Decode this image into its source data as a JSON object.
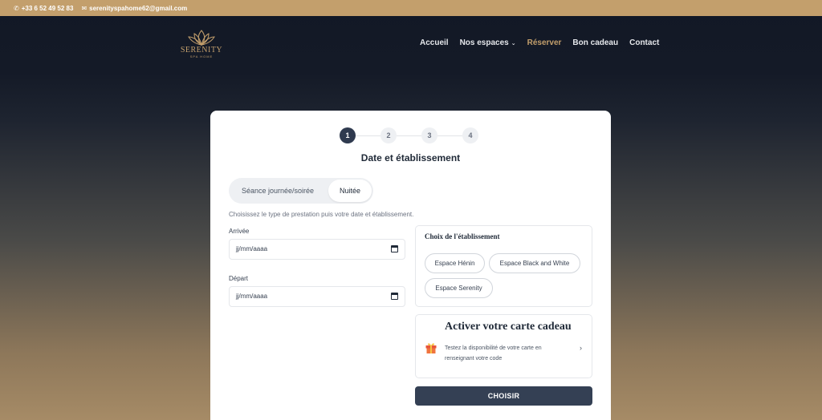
{
  "topbar": {
    "phone": "+33 6 52 49 52 83",
    "email": "serenityspahome62@gmail.com"
  },
  "logo": {
    "name": "SERENITY",
    "sub": "SPA HOME"
  },
  "nav": {
    "items": [
      {
        "label": "Accueil"
      },
      {
        "label": "Nos espaces"
      },
      {
        "label": "Réserver"
      },
      {
        "label": "Bon cadeau"
      },
      {
        "label": "Contact"
      }
    ]
  },
  "stepper": {
    "steps": [
      "1",
      "2",
      "3",
      "4"
    ],
    "current": 1
  },
  "form": {
    "title": "Date et établissement",
    "segment": {
      "option1": "Séance journée/soirée",
      "option2": "Nuitée",
      "selected": "Nuitée"
    },
    "hint": "Choisissez le type de prestation puis votre date et établissement.",
    "arrival_label": "Arrivée",
    "arrival_placeholder": "jj/mm/aaaa",
    "departure_label": "Départ",
    "departure_placeholder": "jj/mm/aaaa",
    "establishment": {
      "title": "Choix de l'établissement",
      "options": [
        "Espace Hénin",
        "Espace Black and White",
        "Espace Serenity"
      ]
    },
    "gift": {
      "title": "Activer votre carte cadeau",
      "text": "Testez la disponibilité de votre carte en renseignant votre code"
    },
    "submit": "CHOISIR"
  },
  "colors": {
    "accent": "#c39f6c",
    "dark": "#344054",
    "header_bg": "#121826"
  },
  "icons": {
    "phone": "phone-icon",
    "email": "envelope-icon",
    "gift": "gift-icon",
    "calendar": "calendar-icon",
    "chevron": "chevron-right-icon"
  }
}
